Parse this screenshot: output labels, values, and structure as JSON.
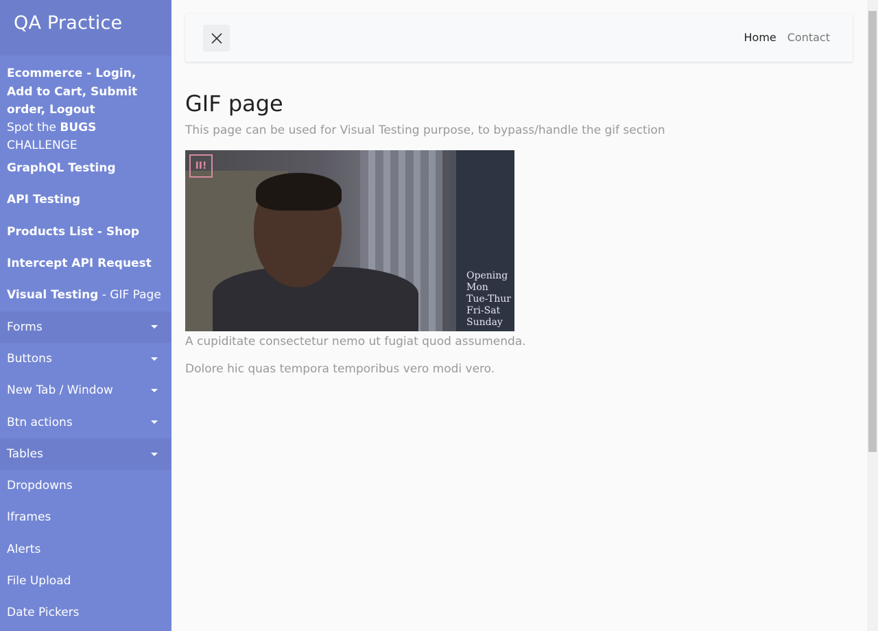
{
  "sidebar": {
    "title": "QA Practice",
    "items": [
      {
        "bold": "Ecommerce - Login, Add to Cart, Submit order, Logout",
        "rest": ""
      },
      {
        "prefix": "Spot the ",
        "bold": "BUGS",
        "rest": " CHALLENGE"
      },
      {
        "bold": "GraphQL Testing",
        "rest": ""
      },
      {
        "bold": "API Testing",
        "rest": ""
      },
      {
        "bold": "Products List - Shop",
        "rest": ""
      },
      {
        "bold": "Intercept API Request",
        "rest": ""
      },
      {
        "bold": "Visual Testing",
        "rest": " - GIF Page"
      }
    ],
    "dropdowns": [
      "Forms",
      "Buttons",
      "New Tab / Window",
      "Btn actions",
      "Tables"
    ],
    "links": [
      "Dropdowns",
      "Iframes",
      "Alerts",
      "File Upload",
      "Date Pickers"
    ]
  },
  "navbar": {
    "home": "Home",
    "contact": "Contact"
  },
  "main": {
    "title": "GIF page",
    "subtitle": "This page can be used for Visual Testing purpose, to bypass/handle the gif section",
    "paragraph1": "A cupiditate consectetur nemo ut fugiat quod assumenda.",
    "paragraph2": "Dolore hic quas tempora temporibus vero modi vero."
  },
  "gif": {
    "badge": "ROLL SAFE",
    "sign_lines": [
      "Opening",
      "Mon",
      "Tue-Thur",
      "Fri-Sat",
      "Sunday"
    ]
  }
}
